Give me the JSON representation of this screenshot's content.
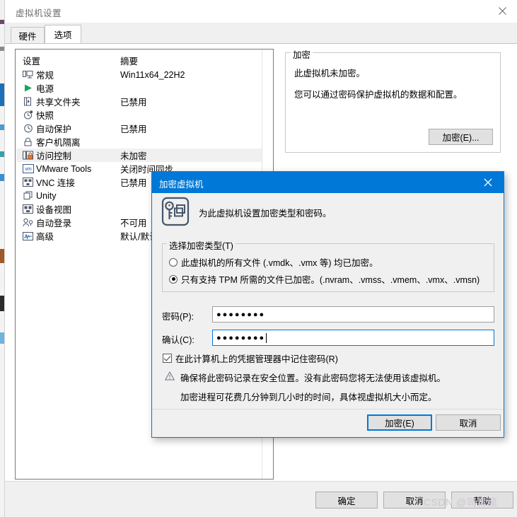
{
  "window": {
    "title": "虚拟机设置",
    "close_icon": "close-icon"
  },
  "tabs": [
    {
      "label": "硬件",
      "active": false
    },
    {
      "label": "选项",
      "active": true
    }
  ],
  "settings_list": {
    "headers": {
      "setting": "设置",
      "summary": "摘要"
    },
    "rows": [
      {
        "icon": "monitor-icon",
        "label": "常规",
        "summary": "Win11x64_22H2",
        "selected": false
      },
      {
        "icon": "play-icon",
        "label": "电源",
        "summary": "",
        "selected": false
      },
      {
        "icon": "shared-folder-icon",
        "label": "共享文件夹",
        "summary": "已禁用",
        "selected": false
      },
      {
        "icon": "snapshot-icon",
        "label": "快照",
        "summary": "",
        "selected": false
      },
      {
        "icon": "autoprotect-icon",
        "label": "自动保护",
        "summary": "已禁用",
        "selected": false
      },
      {
        "icon": "lock-icon",
        "label": "客户机隔离",
        "summary": "",
        "selected": false
      },
      {
        "icon": "access-control-icon",
        "label": "访问控制",
        "summary": "未加密",
        "selected": true
      },
      {
        "icon": "vmware-tools-icon",
        "label": "VMware Tools",
        "summary": "关闭时间同步",
        "selected": false
      },
      {
        "icon": "vnc-icon",
        "label": "VNC 连接",
        "summary": "已禁用",
        "selected": false
      },
      {
        "icon": "unity-icon",
        "label": "Unity",
        "summary": "",
        "selected": false
      },
      {
        "icon": "device-view-icon",
        "label": "设备视图",
        "summary": "",
        "selected": false
      },
      {
        "icon": "autologon-icon",
        "label": "自动登录",
        "summary": "不可用",
        "selected": false
      },
      {
        "icon": "advanced-icon",
        "label": "高级",
        "summary": "默认/默认",
        "selected": false
      }
    ]
  },
  "encryption_panel": {
    "legend": "加密",
    "line1": "此虚拟机未加密。",
    "line2": "您可以通过密码保护虚拟机的数据和配置。",
    "button_label": "加密(E)..."
  },
  "footer_buttons": {
    "ok": "确定",
    "cancel": "取消",
    "help": "帮助"
  },
  "watermark": {
    "prefix": "CSDN @",
    "name": "司青龍"
  },
  "dialog": {
    "title": "加密虚拟机",
    "close_icon": "close-icon",
    "key_icon": "key-vm-icon",
    "header_text": "为此虚拟机设置加密类型和密码。",
    "type_group": {
      "legend": "选择加密类型(T)",
      "options": [
        {
          "label": "此虚拟机的所有文件 (.vmdk、.vmx 等) 均已加密。",
          "checked": false
        },
        {
          "label": "只有支持 TPM 所需的文件已加密。(.nvram、.vmss、.vmem、.vmx、.vmsn)",
          "checked": true
        }
      ]
    },
    "password_label": "密码(P):",
    "password_value": "●●●●●●●●",
    "confirm_label": "确认(C):",
    "confirm_value": "●●●●●●●●",
    "remember_checkbox": {
      "label": "在此计算机上的凭据管理器中记住密码(R)",
      "checked": true
    },
    "warning_icon": "warning-triangle-icon",
    "warning_line1": "确保将此密码记录在安全位置。没有此密码您将无法使用该虚拟机。",
    "warning_line2": "加密进程可花费几分钟到几小时的时间，具体视虚拟机大小而定。",
    "buttons": {
      "encrypt": "加密(E)",
      "cancel": "取消"
    }
  },
  "colors": {
    "accent": "#0078d7",
    "dialog_title_bg": "#0078d7",
    "window_bg": "#f0f0f0",
    "selected_row_bg": "#f0f0f0"
  }
}
